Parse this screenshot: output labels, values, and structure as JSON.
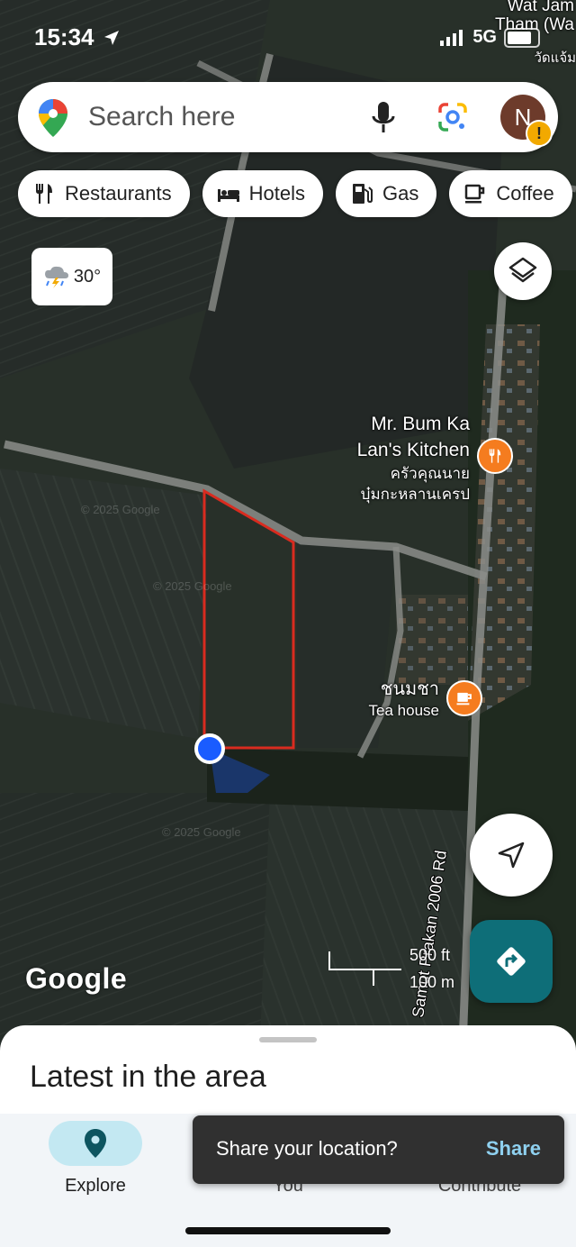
{
  "status": {
    "time": "15:34",
    "network": "5G",
    "location_icon": "location-arrow-icon"
  },
  "search": {
    "placeholder": "Search here",
    "avatar_initial": "N",
    "avatar_warning": "!"
  },
  "chips": [
    {
      "label": "Restaurants",
      "icon": "fork-knife-icon"
    },
    {
      "label": "Hotels",
      "icon": "bed-icon"
    },
    {
      "label": "Gas",
      "icon": "gas-pump-icon"
    },
    {
      "label": "Coffee",
      "icon": "coffee-cup-icon"
    }
  ],
  "weather": {
    "temperature": "30°",
    "icon": "thunderstorm-icon"
  },
  "map_labels": {
    "top_right_1": "Wat Jam",
    "top_right_2": "Tham (Wa",
    "top_right_3": "วัดแจ้ม",
    "poi_restaurant_name_en_1": "Mr. Bum Ka",
    "poi_restaurant_name_en_2": "Lan's Kitchen",
    "poi_restaurant_name_th_1": "ครัวคุณนาย",
    "poi_restaurant_name_th_2": "บุ๋มกะหลานเครป",
    "poi_tea_name_th": "ชนมชา",
    "poi_tea_name_en": "Tea house",
    "road_name": "Samut Prakan 2006 Rd",
    "watermark": "© 2025 Google"
  },
  "scale": {
    "ft": "500 ft",
    "m": "100 m"
  },
  "google_logo": "Google",
  "sheet": {
    "title": "Latest in the area"
  },
  "nav": {
    "explore": "Explore",
    "you": "You",
    "contribute": "Contribute"
  },
  "toast": {
    "message": "Share your location?",
    "action": "Share"
  },
  "colors": {
    "parcel_outline": "#d92b1f",
    "poi_orange": "#f57c1f",
    "directions_teal": "#0e6e78",
    "explore_pill": "#c3e8f2",
    "user_location_blue": "#1a5cff"
  }
}
